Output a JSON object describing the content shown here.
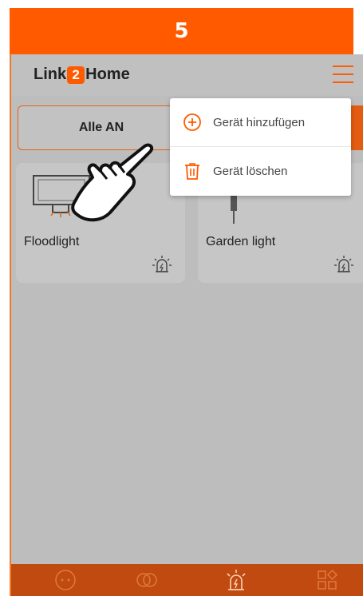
{
  "step": "5",
  "app": {
    "logo_prefix": "Link",
    "logo_digit": "2",
    "logo_suffix": "Home"
  },
  "header": {
    "menu_icon": "hamburger-menu-icon"
  },
  "controls": {
    "all_on_label": "Alle AN"
  },
  "devices": [
    {
      "name": "Floodlight",
      "icon": "floodlight-icon",
      "status_icon": "alarm-light-icon"
    },
    {
      "name": "Garden light",
      "icon": "garden-light-icon",
      "status_icon": "alarm-light-icon"
    }
  ],
  "menu": {
    "items": [
      {
        "label": "Gerät hinzufügen",
        "icon": "add-circle-icon"
      },
      {
        "label": "Gerät löschen",
        "icon": "trash-icon"
      }
    ]
  },
  "bottom_nav": {
    "items": [
      {
        "icon": "smiley-icon"
      },
      {
        "icon": "link-rings-icon"
      },
      {
        "icon": "alarm-light-icon"
      },
      {
        "icon": "grid-icon"
      }
    ]
  },
  "colors": {
    "accent": "#ff5a00",
    "overlay_gray": "#bdbdbd",
    "nav_bar": "#c04a10"
  }
}
